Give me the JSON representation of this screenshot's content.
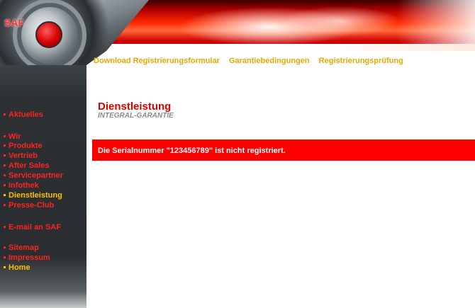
{
  "brand": {
    "logo_text": "SAF"
  },
  "top_links": [
    {
      "label": "Download Registrierungsformular"
    },
    {
      "label": "Garantiebedingungen"
    },
    {
      "label": "Registrierungsprüfung"
    }
  ],
  "sidebar": {
    "items": [
      {
        "label": "Aktuelles"
      },
      {
        "label": "Wir"
      },
      {
        "label": "Produkte"
      },
      {
        "label": "Vertrieb"
      },
      {
        "label": "After Sales"
      },
      {
        "label": "Servicepartner"
      },
      {
        "label": "Infothek"
      },
      {
        "label": "Dienstleistung"
      },
      {
        "label": "Presse-Club"
      },
      {
        "label": "E-mail an SAF"
      },
      {
        "label": "Sitemap"
      },
      {
        "label": "Impressum"
      },
      {
        "label": "Home"
      }
    ]
  },
  "main": {
    "title": "Dienstleistung",
    "subtitle": "INTEGRAL-GARANTIE",
    "error_message": "Die Serialnummer \"123456789\" ist nicht registriert."
  },
  "colors": {
    "accent_red": "#ff0000",
    "link_gold": "#e8a800",
    "active_nav": "#ffc000",
    "sidebar_bg": "#2c3033"
  }
}
